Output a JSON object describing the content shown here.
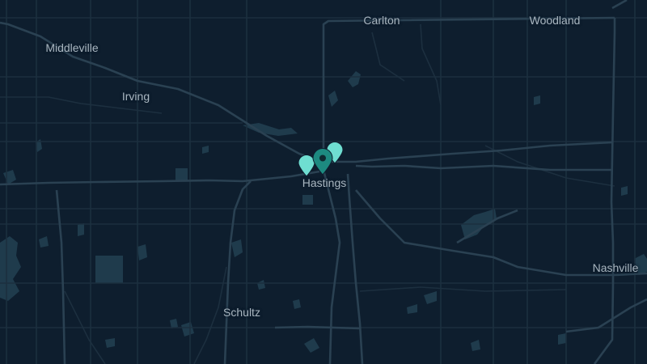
{
  "map": {
    "colors": {
      "background": "#0e1e2e",
      "minor_road": "#1c2f3f",
      "major_road": "#2a4152",
      "water": "#1f3b4c",
      "label": "#a9b6c0",
      "pin": "#6fded1",
      "pin_selected": "#1d8a80"
    },
    "places": {
      "carlton": "Carlton",
      "woodland": "Woodland",
      "middleville": "Middleville",
      "irving": "Irving",
      "hastings": "Hastings",
      "nashville": "Nashville",
      "schultz": "Schultz"
    },
    "markers": [
      {
        "id": "marker-1",
        "icon": "map-pin-icon",
        "selected": false
      },
      {
        "id": "marker-2",
        "icon": "map-pin-icon",
        "selected": true
      },
      {
        "id": "marker-3",
        "icon": "map-pin-icon",
        "selected": false
      }
    ]
  }
}
